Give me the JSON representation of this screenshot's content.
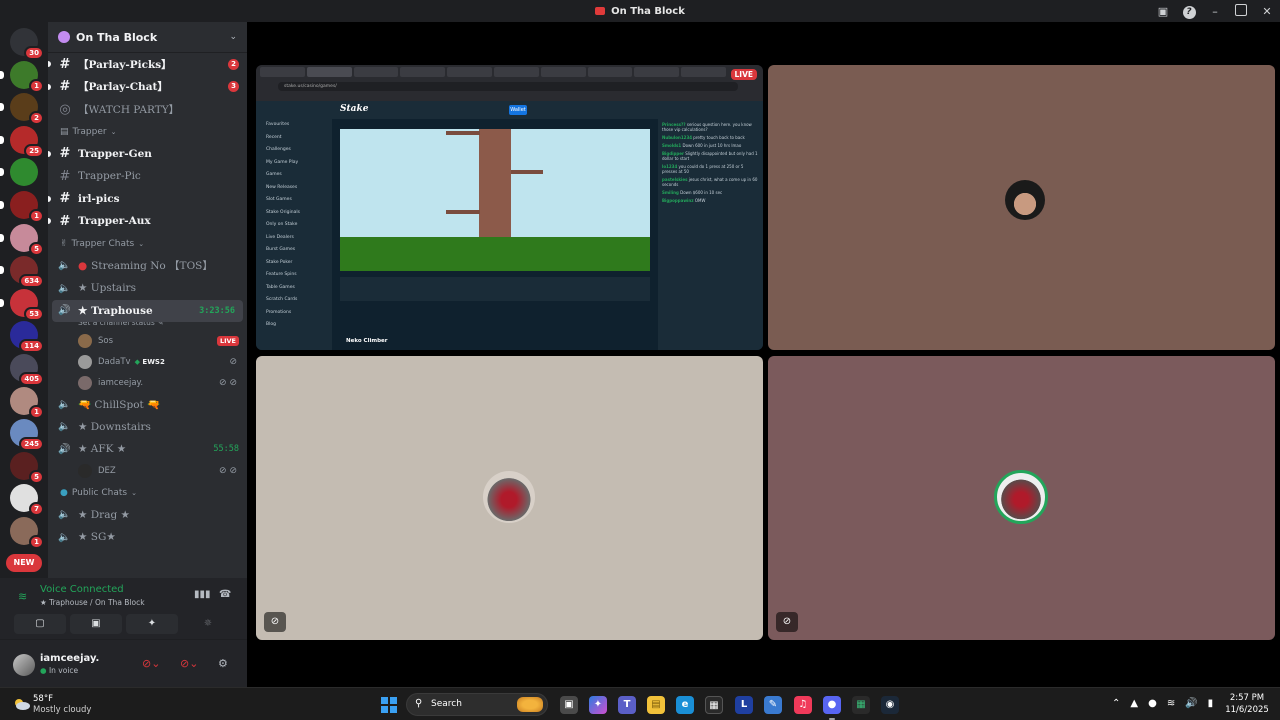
{
  "window": {
    "title": "On Tha Block"
  },
  "rail": {
    "servers": [
      {
        "icon": "discord-home-icon",
        "color": "#313338",
        "badge": "30"
      },
      {
        "icon": "server-icon",
        "color": "#3d7a2a",
        "badge": "1"
      },
      {
        "icon": "server-icon",
        "color": "#5a3d1a",
        "badge": "2"
      },
      {
        "icon": "server-icon",
        "color": "#b52a2a",
        "badge": "25"
      },
      {
        "icon": "server-icon",
        "color": "#2f8a2f",
        "badge": ""
      },
      {
        "icon": "server-icon",
        "color": "#8a1f1f",
        "badge": "1"
      },
      {
        "icon": "server-icon",
        "color": "#c78a9a",
        "badge": "5"
      },
      {
        "icon": "server-icon",
        "color": "#7a2a2a",
        "badge": "634"
      },
      {
        "icon": "server-icon",
        "color": "#c7323a",
        "badge": "53"
      },
      {
        "icon": "server-icon",
        "color": "#2a2a9a",
        "badge": "114"
      },
      {
        "icon": "server-icon",
        "color": "#4a4a5a",
        "badge": "405"
      },
      {
        "icon": "server-icon",
        "color": "#b08a80",
        "badge": "1"
      },
      {
        "icon": "server-icon",
        "color": "#6a8ac0",
        "badge": "245"
      },
      {
        "icon": "server-icon",
        "color": "#5a2020",
        "badge": "5"
      },
      {
        "icon": "server-icon",
        "color": "#e0e0e0",
        "badge": "7"
      },
      {
        "icon": "server-icon",
        "color": "#8a6a5a",
        "badge": "1"
      }
    ],
    "new_label": "NEW"
  },
  "guild": {
    "name": "On Tha Block"
  },
  "channels": {
    "top": [
      {
        "name": "【Parlay-Picks】",
        "badge": "2"
      },
      {
        "name": "【Parlay-Chat】",
        "badge": "3"
      },
      {
        "name": "【WATCH PARTY】",
        "badge": ""
      }
    ],
    "trapper_category": "Trapper",
    "trapper": [
      {
        "name": "Trapper-Gen"
      },
      {
        "name": "Trapper-Pic"
      },
      {
        "name": "irl-pics"
      },
      {
        "name": "Trapper-Aux"
      }
    ],
    "trapper_chats_category": "Trapper Chats",
    "streaming": "Streaming No 【TOS】",
    "upstairs": "★ Upstairs",
    "traphouse": {
      "name": "★ Traphouse",
      "timer": "3:23:56",
      "status": "Set a channel status"
    },
    "voice_users": [
      {
        "name": "Sos",
        "extra": "LIVE",
        "tag": ""
      },
      {
        "name": "DadaTv",
        "extra": "",
        "tag": "EWS2"
      },
      {
        "name": "iamceejay.",
        "extra": "",
        "tag": ""
      }
    ],
    "chillspot": "🔫 ChillSpot 🔫",
    "downstairs": "★ Downstairs",
    "afk": {
      "name": "★ AFK ★",
      "timer": "55:58"
    },
    "afk_user": "DEZ",
    "public_category": "Public Chats",
    "drag": "★ Drag ★",
    "sg": "★ SG★"
  },
  "voice_panel": {
    "status": "Voice Connected",
    "channel": "★ Traphouse / On Tha Block"
  },
  "user_panel": {
    "name": "iamceejay.",
    "sub": "In voice"
  },
  "stage": {
    "stream_live": "LIVE",
    "stream": {
      "site": "Stake",
      "wallet": "Wallet",
      "url": "stake.us/casino/games/",
      "game": "Neko Climber",
      "nav": [
        "Favourites",
        "Recent",
        "Challenges",
        "My Game Play",
        "Games",
        "New Releases",
        "Slot Games",
        "Stake Originals",
        "Only on Stake",
        "Live Dealers",
        "Burst Games",
        "Stake Poker",
        "Feature Spins",
        "Table Games",
        "Scratch Cards",
        "Promotions",
        "Blog"
      ],
      "chat": [
        {
          "user": "Princess??",
          "text": "serious question here. you know those vip calculations?"
        },
        {
          "user": "Nubulon1234",
          "text": "pretty touch back to back"
        },
        {
          "user": "Smolds1",
          "text": "Down 600 in just 10 hrs lmao"
        },
        {
          "user": "Bigdipper",
          "text": "Slightly disappointed but only had 1 dollar to start"
        },
        {
          "user": "lo1234",
          "text": "you could do 1 press at 250 or 5 presses at 50"
        },
        {
          "user": "pastelskies",
          "text": "jesus christ, what a come up in 60 seconds"
        },
        {
          "user": "Smiling",
          "text": "Down $600 in 10 sec"
        },
        {
          "user": "Bigpoppawinz",
          "text": "OMW"
        }
      ]
    }
  },
  "taskbar": {
    "temp": "58°F",
    "condition": "Mostly cloudy",
    "search": "Search",
    "time": "2:57 PM",
    "date": "11/6/2025"
  }
}
